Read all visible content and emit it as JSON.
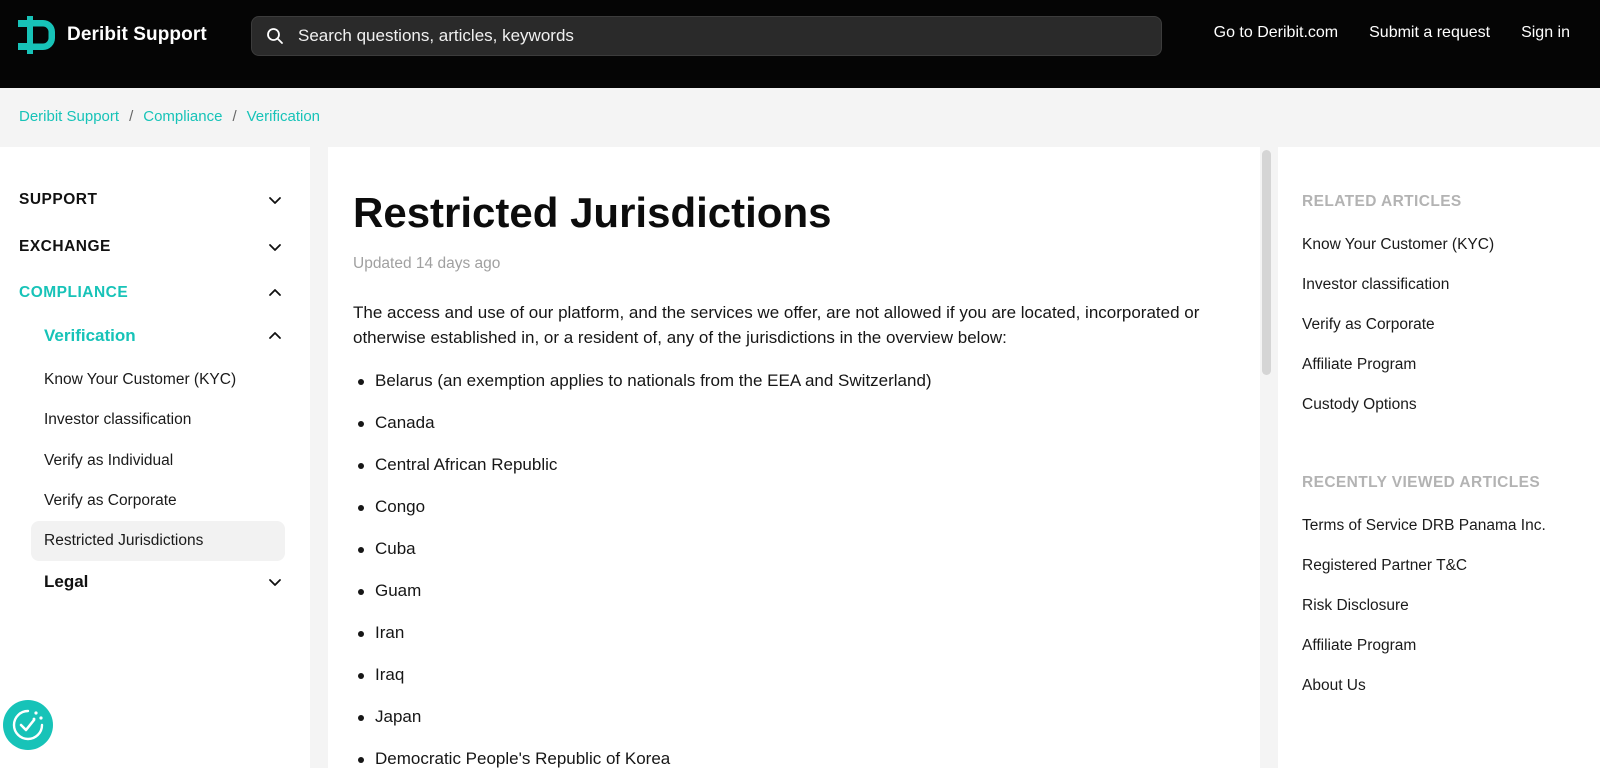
{
  "header": {
    "brand_name": "Deribit Support",
    "search_placeholder": "Search questions, articles, keywords",
    "links": [
      "Go to Deribit.com",
      "Submit a request",
      "Sign in"
    ]
  },
  "breadcrumb": [
    "Deribit Support",
    "Compliance",
    "Verification"
  ],
  "sidebar": {
    "categories": [
      "SUPPORT",
      "EXCHANGE",
      "COMPLIANCE"
    ],
    "sections": [
      "Verification",
      "Legal"
    ],
    "articles": [
      "Know Your Customer (KYC)",
      "Investor classification",
      "Verify as Individual",
      "Verify as Corporate",
      "Restricted Jurisdictions"
    ]
  },
  "article": {
    "title": "Restricted Jurisdictions",
    "updated": "Updated 14 days ago",
    "intro": "The access and use of our platform, and the services we offer, are not allowed if you are located, incorporated or otherwise established in, or a resident of, any of the jurisdictions in the overview below:",
    "jurisdictions": [
      "Belarus (an exemption applies to nationals from the EEA and Switzerland)",
      "Canada",
      "Central African Republic",
      "Congo",
      "Cuba",
      "Guam",
      "Iran",
      "Iraq",
      "Japan",
      "Democratic People's Republic of Korea"
    ]
  },
  "related": {
    "heading": "RELATED ARTICLES",
    "items": [
      "Know Your Customer (KYC)",
      "Investor classification",
      "Verify as Corporate",
      "Affiliate Program",
      "Custody Options"
    ]
  },
  "recent": {
    "heading": "RECENTLY VIEWED ARTICLES",
    "items": [
      "Terms of Service DRB Panama Inc.",
      "Registered Partner T&C",
      "Risk Disclosure",
      "Affiliate Program",
      "About Us"
    ]
  },
  "colors": {
    "accent": "#17c3b8",
    "header_bg": "#050505"
  }
}
